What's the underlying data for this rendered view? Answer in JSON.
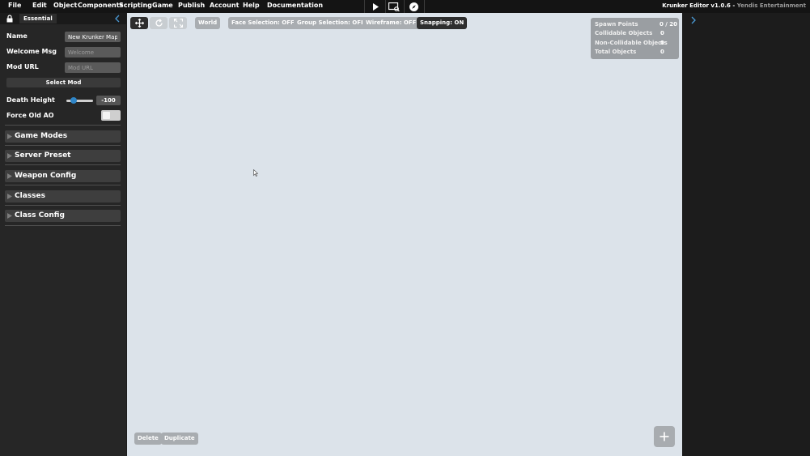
{
  "menu": {
    "items": [
      "File",
      "Edit",
      "Object",
      "Components",
      "Scripting",
      "Game",
      "Publish",
      "Account",
      "Help",
      "Documentation"
    ],
    "play_icon": "play-icon",
    "preview_icon": "screen-preview-icon",
    "compass_icon": "compass-icon",
    "title": "Krunker Editor v1.0.6 - ",
    "brand": "Yendis Entertainment"
  },
  "left_panel": {
    "tab": "Essential",
    "fields": {
      "name_label": "Name",
      "name_value": "New Krunker Map",
      "welcome_label": "Welcome Msg",
      "welcome_placeholder": "Welcome",
      "modurl_label": "Mod URL",
      "modurl_placeholder": "Mod URL"
    },
    "select_mod": "Select Mod",
    "death_height_label": "Death Height",
    "death_height_value": "-100",
    "force_old_ao_label": "Force Old AO",
    "force_old_ao_on": false,
    "sections": [
      "Game Modes",
      "Server Preset",
      "Weapon Config",
      "Classes",
      "Class Config"
    ]
  },
  "toolbar": {
    "world": "World",
    "face_selection": "Face Selection: OFF",
    "group_selection": "Group Selection: OFF",
    "wireframe": "Wireframe: OFF",
    "snapping": "Snapping: ON"
  },
  "stats": {
    "spawn_points_label": "Spawn Points",
    "spawn_points_value": "0 / 20",
    "collidable_label": "Collidable Objects",
    "collidable_value": "0",
    "non_collidable_label": "Non-Collidable Objects",
    "non_collidable_value": "0",
    "total_label": "Total Objects",
    "total_value": "0"
  },
  "bottom": {
    "delete": "Delete",
    "duplicate": "Duplicate"
  },
  "colors": {
    "viewport": "#dce3ea",
    "panel": "#262626",
    "menubar": "#141414",
    "slider_thumb": "#2f86c8"
  }
}
